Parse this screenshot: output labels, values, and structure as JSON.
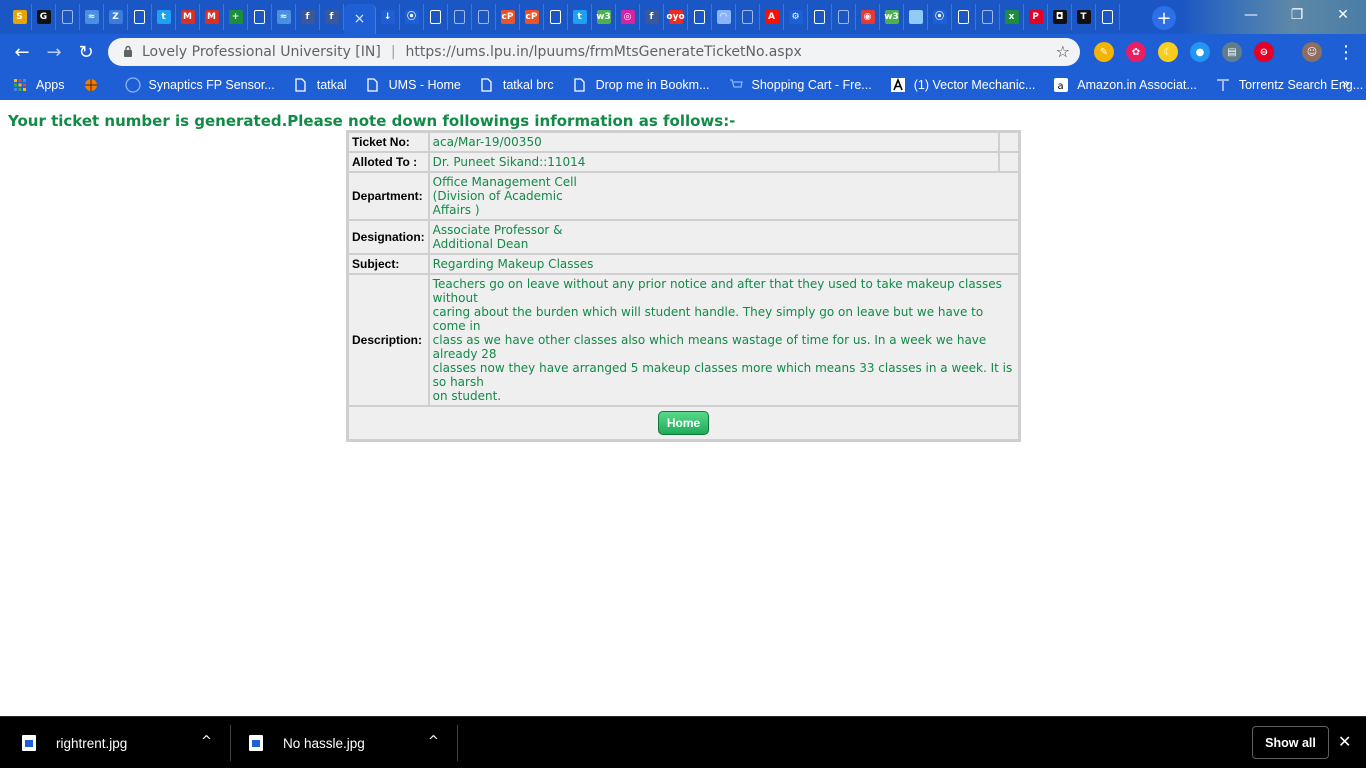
{
  "browser": {
    "tabs": [
      {
        "icon": "slack-icon",
        "glyph": "S",
        "color": "#e8a400"
      },
      {
        "icon": "grammarly-icon",
        "glyph": "G",
        "color": "#111111"
      },
      {
        "icon": "document-icon",
        "glyph": "",
        "color": "#9fb9ec"
      },
      {
        "icon": "stack-icon",
        "glyph": "≈",
        "color": "#4a90e2"
      },
      {
        "icon": "zoho-icon",
        "glyph": "Z",
        "color": "#3b7ddd"
      },
      {
        "icon": "document-icon",
        "glyph": "",
        "color": "#ffffff"
      },
      {
        "icon": "twitter-icon",
        "glyph": "t",
        "color": "#1da1f2"
      },
      {
        "icon": "gmail-icon",
        "glyph": "M",
        "color": "#d93025"
      },
      {
        "icon": "gmail-icon",
        "glyph": "M",
        "color": "#d93025"
      },
      {
        "icon": "plus-green-icon",
        "glyph": "+",
        "color": "#1e8e3e"
      },
      {
        "icon": "document-icon",
        "glyph": "",
        "color": "#ffffff"
      },
      {
        "icon": "stack-icon",
        "glyph": "≈",
        "color": "#4a90e2"
      },
      {
        "icon": "facebook-icon",
        "glyph": "f",
        "color": "#3b5998"
      },
      {
        "icon": "facebook-icon",
        "glyph": "f",
        "color": "#3b5998"
      },
      {
        "icon": "active-tab-close-icon",
        "glyph": "×",
        "color": "",
        "active": true
      },
      {
        "icon": "download-icon",
        "glyph": "↓",
        "color": "#1e5fd6"
      },
      {
        "icon": "map-pin-icon",
        "glyph": "⦿",
        "color": "#1e5fd6"
      },
      {
        "icon": "document-icon",
        "glyph": "",
        "color": "#ffffff"
      },
      {
        "icon": "document-icon",
        "glyph": "",
        "color": "#9fb9ec"
      },
      {
        "icon": "document-icon",
        "glyph": "",
        "color": "#9fb9ec"
      },
      {
        "icon": "cp-icon",
        "glyph": "cP",
        "color": "#e8532a"
      },
      {
        "icon": "cp-icon",
        "glyph": "cP",
        "color": "#e8532a"
      },
      {
        "icon": "document-icon",
        "glyph": "",
        "color": "#ffffff"
      },
      {
        "icon": "twitter-icon",
        "glyph": "t",
        "color": "#1da1f2"
      },
      {
        "icon": "w3-icon",
        "glyph": "w3",
        "color": "#4caf50"
      },
      {
        "icon": "instagram-icon",
        "glyph": "◎",
        "color": "#d6249f"
      },
      {
        "icon": "facebook-icon",
        "glyph": "f",
        "color": "#3b5998"
      },
      {
        "icon": "oyo-icon",
        "glyph": "oyo",
        "color": "#ee2a24"
      },
      {
        "icon": "document-icon",
        "glyph": "",
        "color": "#ffffff"
      },
      {
        "icon": "cloud-icon",
        "glyph": "◠",
        "color": "#8ab4f8"
      },
      {
        "icon": "document-icon",
        "glyph": "",
        "color": "#9fb9ec"
      },
      {
        "icon": "adobe-icon",
        "glyph": "A",
        "color": "#fa0f00"
      },
      {
        "icon": "gear-icon",
        "glyph": "⚙",
        "color": "#1e5fd6"
      },
      {
        "icon": "document-icon",
        "glyph": "",
        "color": "#ffffff"
      },
      {
        "icon": "document-icon",
        "glyph": "",
        "color": "#9fb9ec"
      },
      {
        "icon": "power-icon",
        "glyph": "◉",
        "color": "#e53935"
      },
      {
        "icon": "w3-icon",
        "glyph": "w3",
        "color": "#4caf50"
      },
      {
        "icon": "stripe-icon",
        "glyph": "",
        "color": "#90caf9"
      },
      {
        "icon": "map-pin-icon",
        "glyph": "⦿",
        "color": "#1e5fd6"
      },
      {
        "icon": "document-icon",
        "glyph": "",
        "color": "#ffffff"
      },
      {
        "icon": "document-icon",
        "glyph": "",
        "color": "#9fb9ec"
      },
      {
        "icon": "x-green-icon",
        "glyph": "x",
        "color": "#1e8e3e"
      },
      {
        "icon": "pinterest-icon",
        "glyph": "P",
        "color": "#e60023"
      },
      {
        "icon": "dark-app-icon",
        "glyph": "◘",
        "color": "#111111"
      },
      {
        "icon": "t-icon",
        "glyph": "T",
        "color": "#111111"
      },
      {
        "icon": "document-icon",
        "glyph": "",
        "color": "#ffffff"
      }
    ],
    "new_tab": "+",
    "window": {
      "minimize": "—",
      "restore": "❐",
      "close": "✕"
    }
  },
  "toolbar": {
    "back": "←",
    "forward": "→",
    "reload": "↻",
    "site_name": "Lovely Professional University [IN]",
    "separator": "|",
    "url": "https://ums.lpu.in/lpuums/frmMtsGenerateTicketNo.aspx",
    "star": "☆",
    "extensions": [
      {
        "icon": "paint-extension-icon",
        "glyph": "✎",
        "color": "#f4b400"
      },
      {
        "icon": "color-picker-icon",
        "glyph": "✿",
        "color": "#e91e63"
      },
      {
        "icon": "moon-icon",
        "glyph": "☾",
        "color": "#f9ce1d"
      },
      {
        "icon": "circle-extension-icon",
        "glyph": "●",
        "color": "#2196f3"
      },
      {
        "icon": "translate-extension-icon",
        "glyph": "▤",
        "color": "#607d8b"
      },
      {
        "icon": "pinterest-save-icon",
        "glyph": "⊖",
        "color": "#e60023"
      },
      {
        "icon": "profile-avatar",
        "glyph": "☺",
        "color": "#8d6e63"
      }
    ],
    "menu": "⋮"
  },
  "bookmarks": [
    {
      "icon": "apps-grid-icon",
      "label": "Apps"
    },
    {
      "icon": "basketball-icon",
      "label": ""
    },
    {
      "icon": "dell-icon",
      "label": "Synaptics FP Sensor..."
    },
    {
      "icon": "page-icon",
      "label": "tatkal"
    },
    {
      "icon": "page-icon",
      "label": "UMS - Home"
    },
    {
      "icon": "page-icon",
      "label": "tatkal brc"
    },
    {
      "icon": "page-icon",
      "label": "Drop me in Bookm..."
    },
    {
      "icon": "cart-icon",
      "label": "Shopping Cart - Fre..."
    },
    {
      "icon": "vector-a-icon",
      "label": "(1) Vector Mechanic..."
    },
    {
      "icon": "amazon-icon",
      "label": "Amazon.in Associat..."
    },
    {
      "icon": "torrentz-icon",
      "label": "Torrentz Search Eng..."
    }
  ],
  "bookmarks_more": "»",
  "page": {
    "heading": "Your ticket number is generated.Please note down followings information as follows:-",
    "rows": [
      {
        "label": "Ticket No:",
        "value": [
          "aca/Mar-19/00350"
        ]
      },
      {
        "label": "Alloted To :",
        "value": [
          "Dr. Puneet Sikand::11014"
        ]
      },
      {
        "label": "Department:",
        "value": [
          "Office Management Cell",
          "(Division of Academic",
          "Affairs )"
        ]
      },
      {
        "label": "Designation:",
        "value": [
          "Associate Professor &",
          "Additional Dean"
        ]
      },
      {
        "label": "Subject:",
        "value": [
          "Regarding Makeup Classes"
        ]
      },
      {
        "label": "Description:",
        "value": [
          "Teachers go on leave without any prior notice and after that they used to take makeup classes without",
          "caring about the burden which will student handle. They simply go on leave but we have to come in",
          "class as we have other classes also which means wastage of time for us. In a week we have already 28",
          "classes now they have arranged 5 makeup classes more which means 33 classes in a week. It is so harsh",
          "on student."
        ]
      }
    ],
    "home_button": "Home"
  },
  "downloads": {
    "items": [
      {
        "name": "rightrent.jpg",
        "chevron": "^"
      },
      {
        "name": "No hassle.jpg",
        "chevron": "^"
      }
    ],
    "show_all": "Show all",
    "close": "✕"
  },
  "colors": {
    "chrome_blue": "#1e5fd6",
    "page_green": "#128a48",
    "table_bg": "#efefef"
  }
}
